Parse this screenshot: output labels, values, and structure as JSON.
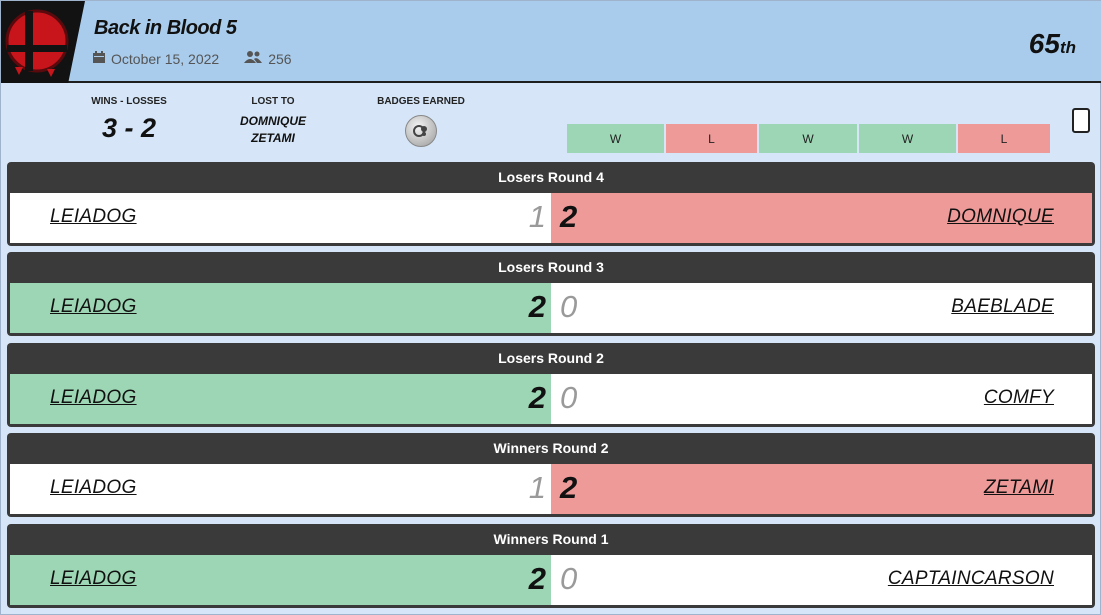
{
  "event": {
    "title": "Back in Blood 5",
    "date": "October 15, 2022",
    "entrants": "256",
    "placement_number": "65",
    "placement_suffix": "th"
  },
  "summary": {
    "wins_losses_label": "WINS - LOSSES",
    "wins_losses_value": "3 - 2",
    "lost_to_label": "LOST TO",
    "lost_to": [
      "DOMNIQUE",
      "ZETAMI"
    ],
    "badges_label": "BADGES EARNED",
    "results": [
      "W",
      "L",
      "W",
      "W",
      "L"
    ]
  },
  "colors": {
    "win": "#9dd6b4",
    "loss": "#ee9a99",
    "header_bg": "#a9ccec",
    "match_bar": "#3a3a3a"
  },
  "icons": {
    "date": "calendar-icon",
    "entrants": "users-icon",
    "badge": "badge-icon",
    "logo": "smash-logo-icon"
  },
  "matches": [
    {
      "round": "Losers Round 4",
      "player": "LEIADOG",
      "player_score": "1",
      "opponent": "DOMNIQUE",
      "opponent_score": "2",
      "won": false
    },
    {
      "round": "Losers Round 3",
      "player": "LEIADOG",
      "player_score": "2",
      "opponent": "BAEBLADE",
      "opponent_score": "0",
      "won": true
    },
    {
      "round": "Losers Round 2",
      "player": "LEIADOG",
      "player_score": "2",
      "opponent": "COMFY",
      "opponent_score": "0",
      "won": true
    },
    {
      "round": "Winners Round 2",
      "player": "LEIADOG",
      "player_score": "1",
      "opponent": "ZETAMI",
      "opponent_score": "2",
      "won": false
    },
    {
      "round": "Winners Round 1",
      "player": "LEIADOG",
      "player_score": "2",
      "opponent": "CAPTAINCARSON",
      "opponent_score": "0",
      "won": true
    }
  ]
}
